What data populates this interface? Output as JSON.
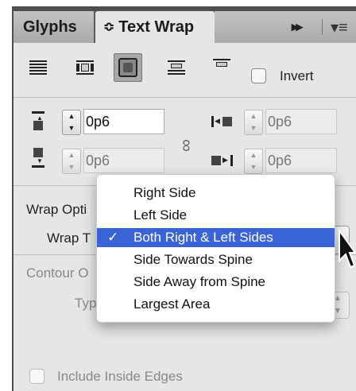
{
  "tabs": {
    "glyphs": "Glyphs",
    "text_wrap": "Text Wrap"
  },
  "tab_controls": {
    "text_wrap_arrows": "≎",
    "fast_forward": "▸▸",
    "panel_menu": "▾≡"
  },
  "wrap_icons": [
    "no-text-wrap-icon",
    "wrap-around-bounding-box-icon",
    "wrap-around-object-shape-icon",
    "jump-object-icon",
    "jump-to-next-column-icon"
  ],
  "invert": {
    "label": "Invert",
    "checked": false
  },
  "offsets": {
    "top": "0p6",
    "bottom": "0p6",
    "left": "0p6",
    "right": "0p6"
  },
  "stepper_glyphs": {
    "up": "▲",
    "down": "▼"
  },
  "link_icon_glyph": "∞",
  "wrap_options_label": "Wrap Opti",
  "wrap_to_label": "Wrap T",
  "contour_label": "Contour O",
  "type_label": "Typ",
  "wrap_to_menu": {
    "options": [
      "Right Side",
      "Left Side",
      "Both Right & Left Sides",
      "Side Towards Spine",
      "Side Away from Spine",
      "Largest Area"
    ],
    "selected": "Both Right & Left Sides",
    "checkmark": "✓"
  },
  "include_inside_edges": {
    "label": "Include Inside Edges",
    "checked": false
  },
  "colors": {
    "selection": "#3a63d7",
    "panel_bg": "#e6e6e6"
  }
}
